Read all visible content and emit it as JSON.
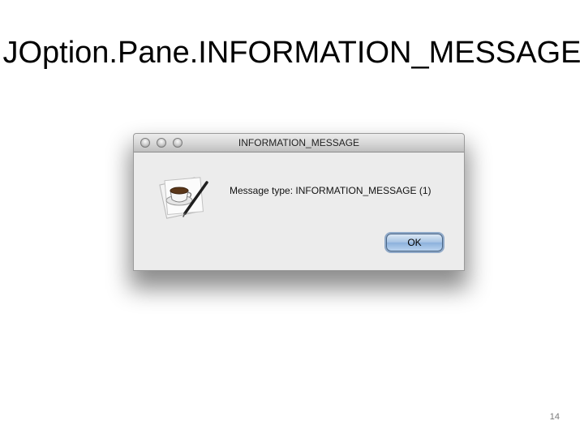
{
  "slide": {
    "title": "JOption.Pane.INFORMATION_MESSAGE",
    "page_number": "14"
  },
  "dialog": {
    "window_title": "INFORMATION_MESSAGE",
    "message": "Message type: INFORMATION_MESSAGE (1)",
    "ok_label": "OK",
    "icon": "java-coffee-cup-icon",
    "traffic_lights": [
      "close",
      "minimize",
      "zoom"
    ]
  },
  "colors": {
    "dialog_background": "#ececec",
    "ok_button_accent": "#8cb1dc"
  }
}
